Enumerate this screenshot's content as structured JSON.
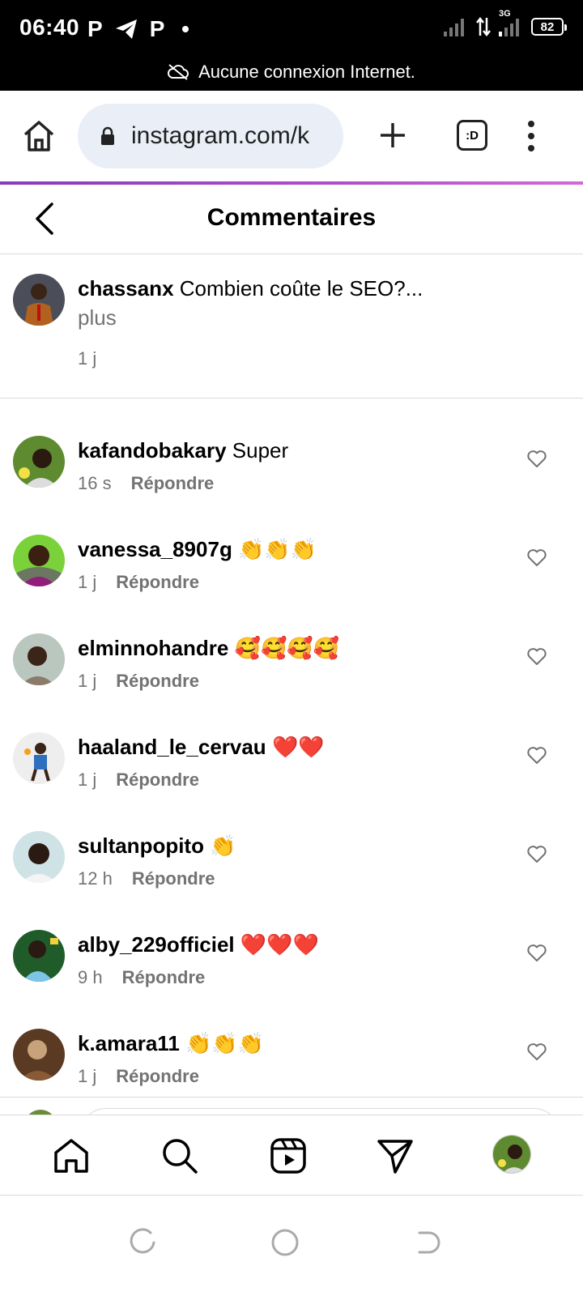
{
  "status_bar": {
    "time": "06:40",
    "app_icons": [
      "P",
      "telegram-icon",
      "P"
    ],
    "network": "3G",
    "battery": "82",
    "notice": "Aucune connexion Internet."
  },
  "browser": {
    "url": "instagram.com/k",
    "tabs_label": ":D"
  },
  "header": {
    "title": "Commentaires"
  },
  "caption": {
    "username": "chassanx",
    "text": "Combien coûte le SEO?...",
    "more": "plus",
    "time": "1 j"
  },
  "comments": [
    {
      "username": "kafandobakary",
      "text": "Super",
      "time": "16 s",
      "reply": "Répondre"
    },
    {
      "username": "vanessa_8907g",
      "text": "👏👏👏",
      "time": "1 j",
      "reply": "Répondre"
    },
    {
      "username": "elminnohandre",
      "text": "🥰🥰🥰🥰",
      "time": "1 j",
      "reply": "Répondre"
    },
    {
      "username": "haaland_le_cervau",
      "text": "❤️❤️",
      "time": "1 j",
      "reply": "Répondre"
    },
    {
      "username": "sultanpopito",
      "text": "👏",
      "time": "12 h",
      "reply": "Répondre"
    },
    {
      "username": "alby_229officiel",
      "text": "❤️❤️❤️",
      "time": "9 h",
      "reply": "Répondre"
    },
    {
      "username": "k.amara11",
      "text": "👏👏👏",
      "time": "1 j",
      "reply": "Répondre"
    }
  ],
  "colors": {
    "accent_gradient": [
      "#8a3ab9",
      "#d06ad6"
    ],
    "muted_text": "#737373",
    "url_pill": "#e9eef7"
  }
}
